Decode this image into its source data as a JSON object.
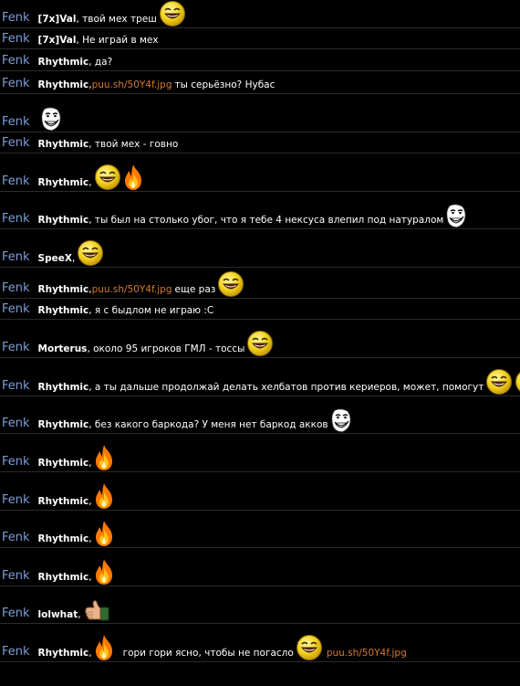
{
  "messages": [
    {
      "author": "Fenk",
      "to": "[7x]Val",
      "text": ", твой мех треш",
      "emoticons": [
        "laughing-smiley-icon"
      ]
    },
    {
      "author": "Fenk",
      "to": "[7x]Val",
      "text": ", Не играй в мех",
      "emoticons": []
    },
    {
      "author": "Fenk",
      "to": "Rhythmic",
      "text": ", да?",
      "emoticons": []
    },
    {
      "author": "Fenk",
      "to": "Rhythmic",
      "text": ", ",
      "link": "puu.sh/50Y4f.jpg",
      "text2": "ты серьёзно? Нубас",
      "emoticons": []
    },
    {
      "author": "Fenk",
      "to": "",
      "text": "",
      "emoticons": [
        "troll-face-icon"
      ]
    },
    {
      "author": "Fenk",
      "to": "Rhythmic",
      "text": ", твой мех - говно",
      "emoticons": []
    },
    {
      "author": "Fenk",
      "to": "Rhythmic",
      "text": ",",
      "emoticons": [
        "laughing-smiley-icon",
        "fire-icon"
      ]
    },
    {
      "author": "Fenk",
      "to": "Rhythmic",
      "text": ", ты был на столько убог, что я тебе 4 нексуса влепил под натуралом",
      "emoticons": [
        "troll-face-icon"
      ]
    },
    {
      "author": "Fenk",
      "to": "SpeeX",
      "text": ",",
      "emoticons": [
        "laughing-smiley-icon"
      ]
    },
    {
      "author": "Fenk",
      "to": "Rhythmic",
      "text": ", ",
      "link": "puu.sh/50Y4f.jpg",
      "text2": "еще раз",
      "emoticons": [
        "laughing-smiley-icon"
      ]
    },
    {
      "author": "Fenk",
      "to": "Rhythmic",
      "text": ", я с быдлом не играю :С",
      "emoticons": []
    },
    {
      "author": "Fenk",
      "to": "Morterus",
      "text": ", около 95 игроков ГМЛ - тоссы",
      "emoticons": [
        "laughing-smiley-icon"
      ]
    },
    {
      "author": "Fenk",
      "to": "Rhythmic",
      "text": ", а ты дальше продолжай делать хелбатов против кериеров, может, помогут",
      "emoticons": [
        "laughing-smiley-icon",
        "laughing-smiley-icon"
      ]
    },
    {
      "author": "Fenk",
      "to": "Rhythmic",
      "text": ", без какого баркода? У меня нет баркод акков",
      "emoticons": [
        "troll-face-icon"
      ]
    },
    {
      "author": "Fenk",
      "to": "Rhythmic",
      "text": ",",
      "emoticons": [
        "fire-icon"
      ]
    },
    {
      "author": "Fenk",
      "to": "Rhythmic",
      "text": ",",
      "emoticons": [
        "fire-icon"
      ]
    },
    {
      "author": "Fenk",
      "to": "Rhythmic",
      "text": ",",
      "emoticons": [
        "fire-icon"
      ]
    },
    {
      "author": "Fenk",
      "to": "Rhythmic",
      "text": ",",
      "emoticons": [
        "fire-icon"
      ]
    },
    {
      "author": "Fenk",
      "to": "lolwhat",
      "text": ",",
      "emoticons": [
        "thumbs-up-icon"
      ]
    },
    {
      "author": "Fenk",
      "to": "Rhythmic",
      "text": ",",
      "emoticons": [
        "fire-icon"
      ],
      "text2": "гори гори ясно, чтобы не погасло",
      "emoticons2": [
        "laughing-smiley-icon"
      ],
      "link2": "puu.sh/50Y4f.jpg"
    }
  ]
}
